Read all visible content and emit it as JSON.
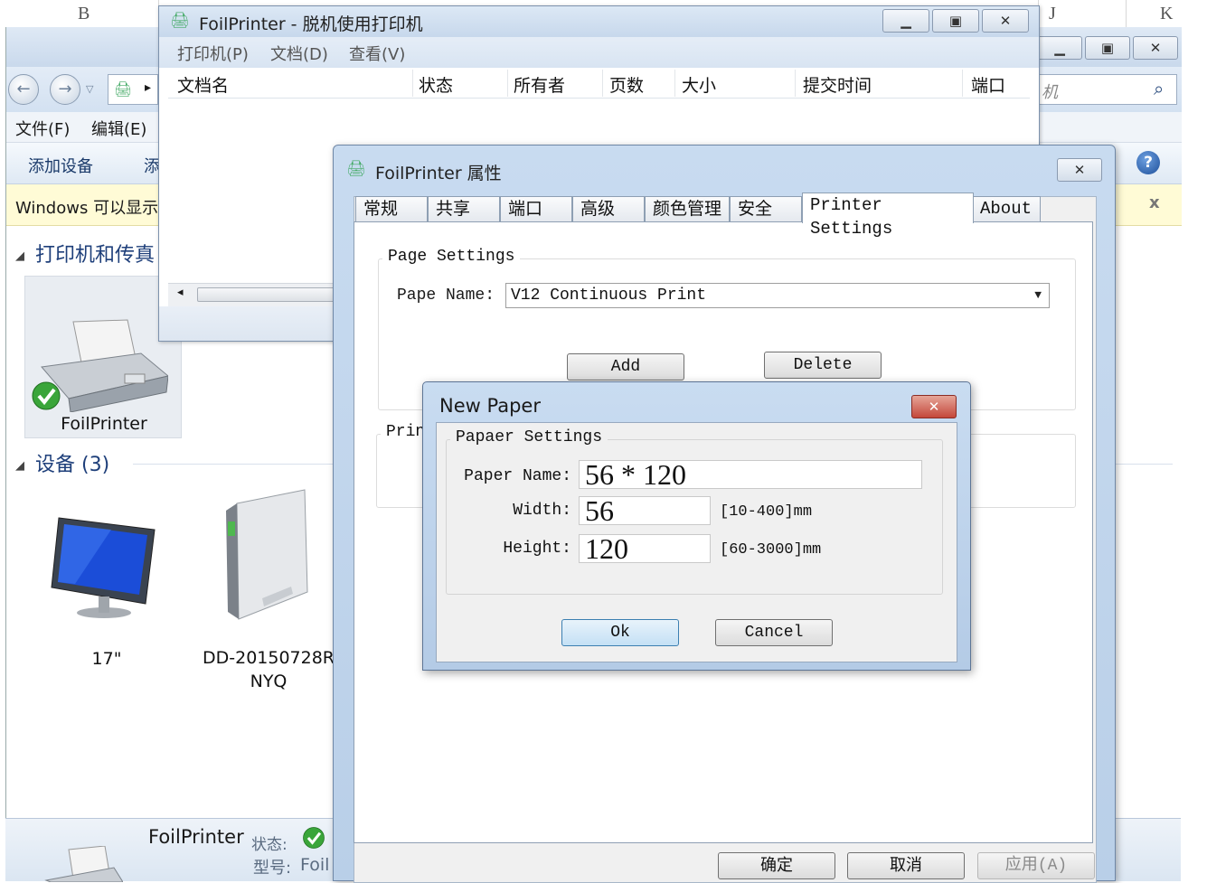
{
  "excel": {
    "col_b": "B",
    "col_j": "J",
    "col_k": "K"
  },
  "explorer": {
    "search_placeholder": "机",
    "menu": {
      "file": "文件(F)",
      "edit": "编辑(E)"
    },
    "commands": {
      "add_device": "添加设备",
      "add_printer": "添"
    },
    "info_bar": "Windows 可以显示",
    "info_close": "x",
    "section_printers": "打印机和传真",
    "printer_label": "FoilPrinter",
    "section_devices": "设备 (3)",
    "device_monitor": "17\"",
    "device_drive_line1": "DD-20150728R",
    "device_drive_line2": "NYQ",
    "details": {
      "name": "FoilPrinter",
      "status_label": "状态:",
      "model_label": "型号:",
      "model_value": "Foil"
    }
  },
  "queue": {
    "title": "FoilPrinter - 脱机使用打印机",
    "menu": {
      "printer": "打印机(P)",
      "document": "文档(D)",
      "view": "查看(V)"
    },
    "columns": [
      "文档名",
      "状态",
      "所有者",
      "页数",
      "大小",
      "提交时间",
      "端口"
    ]
  },
  "props": {
    "title": "FoilPrinter 属性",
    "tabs": [
      "常规",
      "共享",
      "端口",
      "高级",
      "颜色管理",
      "安全",
      "Printer Settings",
      "About"
    ],
    "page_settings_group": "Page Settings",
    "paper_name_label": "Pape Name:",
    "paper_name_value": "V12 Continuous Print",
    "add_button": "Add",
    "delete_button": "Delete",
    "print_group_partial": "Prin",
    "ok": "确定",
    "cancel": "取消",
    "apply": "应用(A)"
  },
  "new_paper": {
    "title": "New Paper",
    "group": "Papaer Settings",
    "name_label": "Paper Name:",
    "name_value": "56 * 120",
    "width_label": "Width:",
    "width_value": "56",
    "width_range": "[10-400]mm",
    "height_label": "Height:",
    "height_value": "120",
    "height_range": "[60-3000]mm",
    "ok": "Ok",
    "cancel": "Cancel"
  },
  "colors": {
    "link_blue": "#1e3f7a",
    "info_yellow": "#fffbd6",
    "close_red": "#c4473a"
  }
}
